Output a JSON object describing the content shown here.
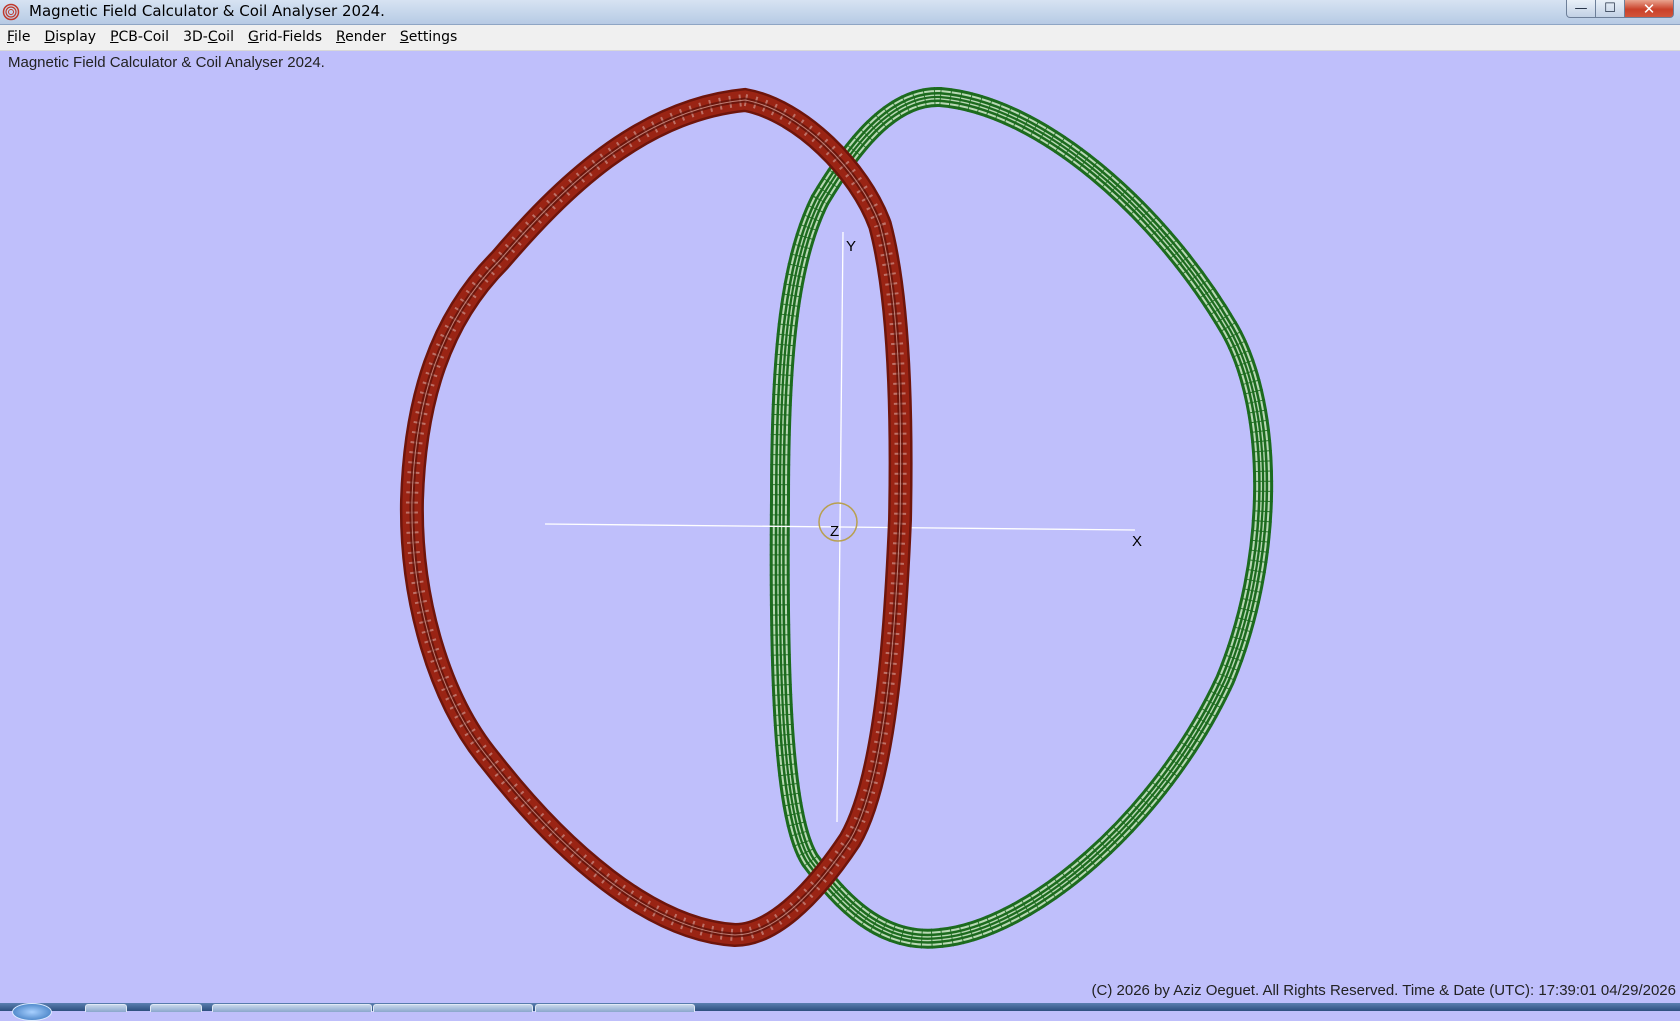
{
  "window": {
    "title": "Magnetic Field Calculator & Coil Analyser 2024.",
    "icon": "coil-app-icon",
    "controls": {
      "minimize": "—",
      "maximize": "☐",
      "close": "✕"
    }
  },
  "menu": [
    {
      "label": "File",
      "accel": "F",
      "rest": "ile"
    },
    {
      "label": "Display",
      "accel": "D",
      "rest": "isplay"
    },
    {
      "label": "PCB-Coil",
      "accel": "P",
      "rest": "CB-Coil"
    },
    {
      "label": "3D-Coil",
      "pre": "3D-",
      "accel": "C",
      "rest": "oil"
    },
    {
      "label": "Grid-Fields",
      "accel": "G",
      "rest": "rid-Fields"
    },
    {
      "label": "Render",
      "accel": "R",
      "rest": "ender"
    },
    {
      "label": "Settings",
      "accel": "S",
      "rest": "ettings"
    }
  ],
  "status_top": "Magnetic Field Calculator & Coil Analyser 2024.",
  "scene": {
    "axes": {
      "x_label": "X",
      "y_label": "Y",
      "z_label": "Z"
    },
    "coils": [
      {
        "name": "coil-red",
        "color": "#8e1a0e"
      },
      {
        "name": "coil-green",
        "color": "#1c6b1e"
      }
    ],
    "axis_color": "#ffffff",
    "z_marker_color": "#b8a050"
  },
  "status_bottom": "(C) 2026  by Aziz Oeguet. All Rights Reserved.  Time & Date (UTC): 17:39:01  04/29/2026"
}
